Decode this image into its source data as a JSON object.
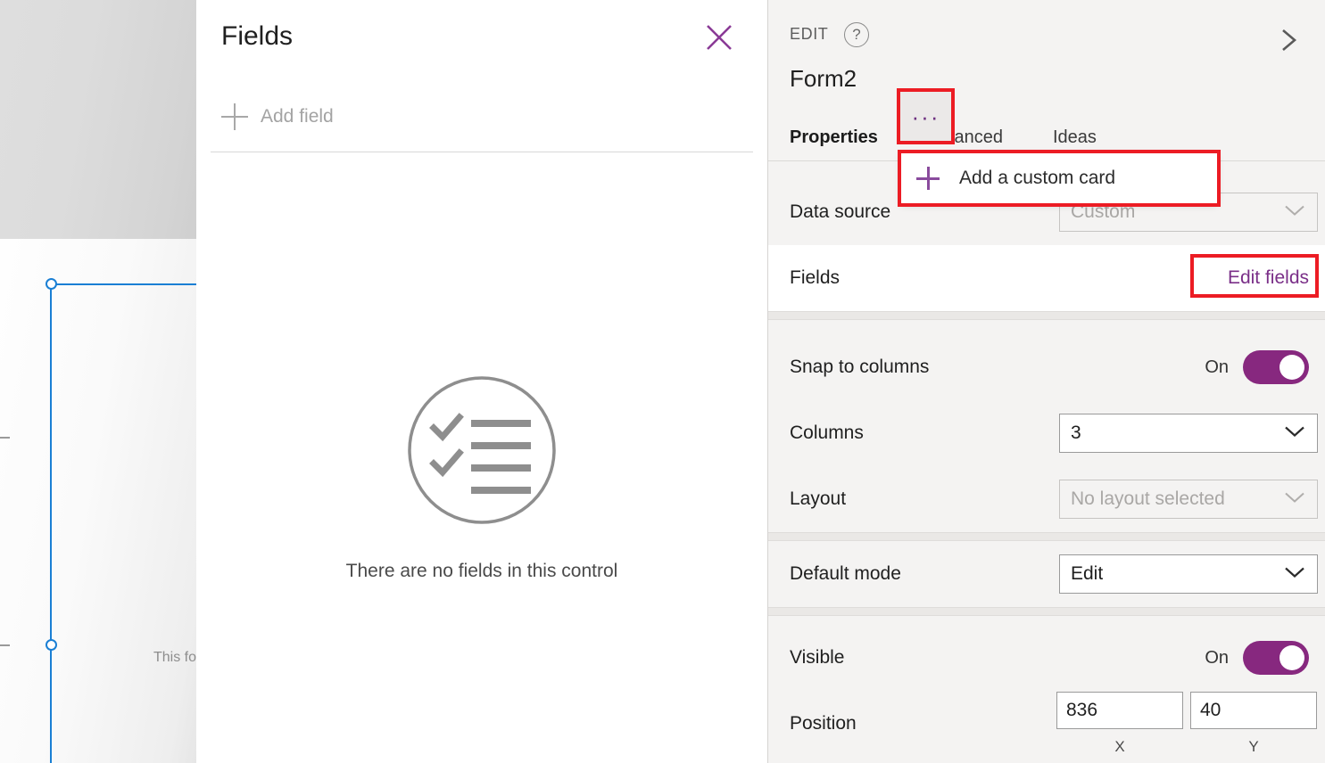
{
  "canvas": {
    "form_hint_text": "This fo"
  },
  "fields_panel": {
    "title": "Fields",
    "close_icon": "close-icon",
    "add_field_label": "Add field",
    "add_field_icon": "plus-icon",
    "more_button_label": "···",
    "context_menu": {
      "items": [
        {
          "label": "Add a custom card",
          "icon": "plus-icon"
        }
      ]
    },
    "empty_state": {
      "icon": "checklist-circle-icon",
      "message": "There are no fields in this control"
    }
  },
  "right_panel": {
    "mode_label": "EDIT",
    "help_icon": "question-circle-icon",
    "help_glyph": "?",
    "collapse_icon": "chevron-right-icon",
    "control_name": "Form2",
    "tabs": [
      {
        "label": "Properties",
        "active": true
      },
      {
        "label": "Advanced",
        "active": false
      },
      {
        "label": "Ideas",
        "active": false
      }
    ],
    "properties": {
      "data_source": {
        "label": "Data source",
        "value": "Custom",
        "disabled": true
      },
      "fields": {
        "label": "Fields",
        "action_label": "Edit fields"
      },
      "snap_to_columns": {
        "label": "Snap to columns",
        "state": "On"
      },
      "columns": {
        "label": "Columns",
        "value": "3"
      },
      "layout": {
        "label": "Layout",
        "value": "No layout selected",
        "disabled": true
      },
      "default_mode": {
        "label": "Default mode",
        "value": "Edit"
      },
      "visible": {
        "label": "Visible",
        "state": "On"
      },
      "position": {
        "label": "Position",
        "x_value": "836",
        "y_value": "40",
        "x_caption": "X",
        "y_caption": "Y"
      }
    }
  },
  "colors": {
    "accent_purple": "#7a2f88",
    "toggle_on": "#87287f",
    "highlight_red": "#ec1c24",
    "selection_blue": "#1a7fd4",
    "panel_bg": "#f4f3f2"
  }
}
